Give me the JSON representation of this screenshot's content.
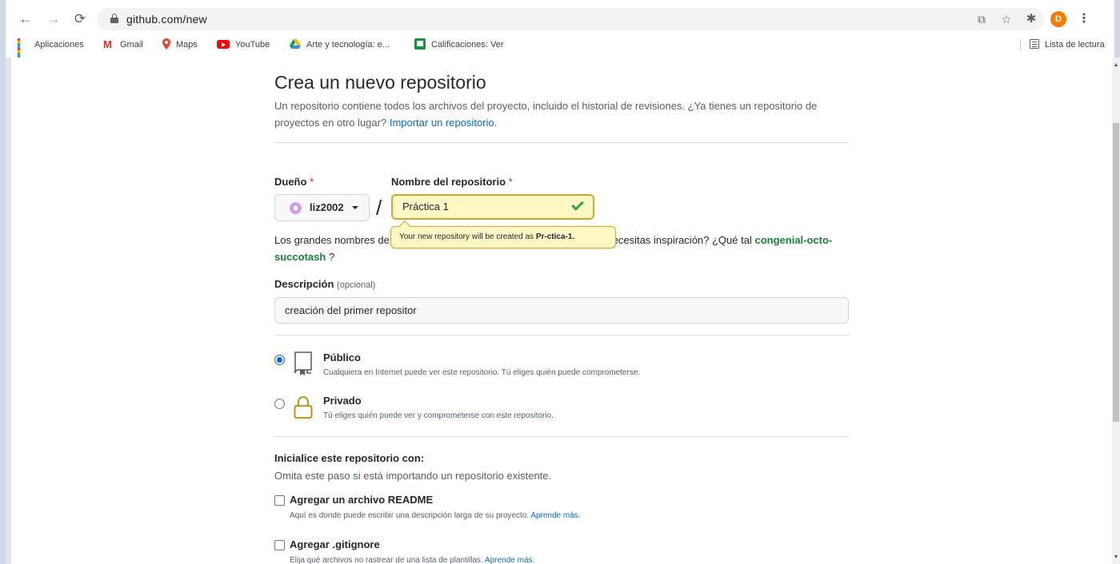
{
  "browser": {
    "url": "github.com/new",
    "avatar_letter": "D",
    "bookmarks": [
      "Aplicaciones",
      "Gmail",
      "Maps",
      "YouTube",
      "Arte y tecnología: e...",
      "Calificaciones: Ver"
    ],
    "reading_list": "Lista de lectura"
  },
  "page": {
    "title": "Crea un nuevo repositorio",
    "subtitle": "Un repositorio contiene todos los archivos del proyecto, incluido el historial de revisiones. ¿Ya tienes un repositorio de proyectos en otro lugar?",
    "import_link": "Importar un repositorio."
  },
  "owner": {
    "label": "Dueño",
    "required": "*",
    "value": "liz2002"
  },
  "repo_name": {
    "label": "Nombre del repositorio",
    "required": "*",
    "value": "Práctica 1"
  },
  "tooltip": {
    "prefix": "Your new repository will be created as",
    "slug": "Pr-ctica-1."
  },
  "hint": {
    "text": "Los grandes nombres de repositorios son cortos y fáciles de recordar. ¿Necesitas inspiración? ¿Qué tal",
    "suggestion": "congenial-octo-succotash",
    "end": "?"
  },
  "description": {
    "label": "Descripción",
    "optional": "(opcional)",
    "value": "creación del primer repositor"
  },
  "visibility": {
    "public_title": "Público",
    "public_desc": "Cualquiera en Internet puede ver este repositorio. Tú eliges quién puede comprometerse.",
    "private_title": "Privado",
    "private_desc": "Tú eliges quién puede ver y comprometerse con este repositorio."
  },
  "init": {
    "title": "Inicialice este repositorio con:",
    "subtitle": "Omita este paso si está importando un repositorio existente.",
    "readme_title": "Agregar un archivo README",
    "readme_desc": "Aquí es donde puede escribir una descripción larga de su proyecto.",
    "readme_link": "Aprende más.",
    "gitignore_title": "Agregar .gitignore",
    "gitignore_desc": "Elija qué archivos no rastrear de una lista de plantillas.",
    "gitignore_link": "Aprende más."
  }
}
